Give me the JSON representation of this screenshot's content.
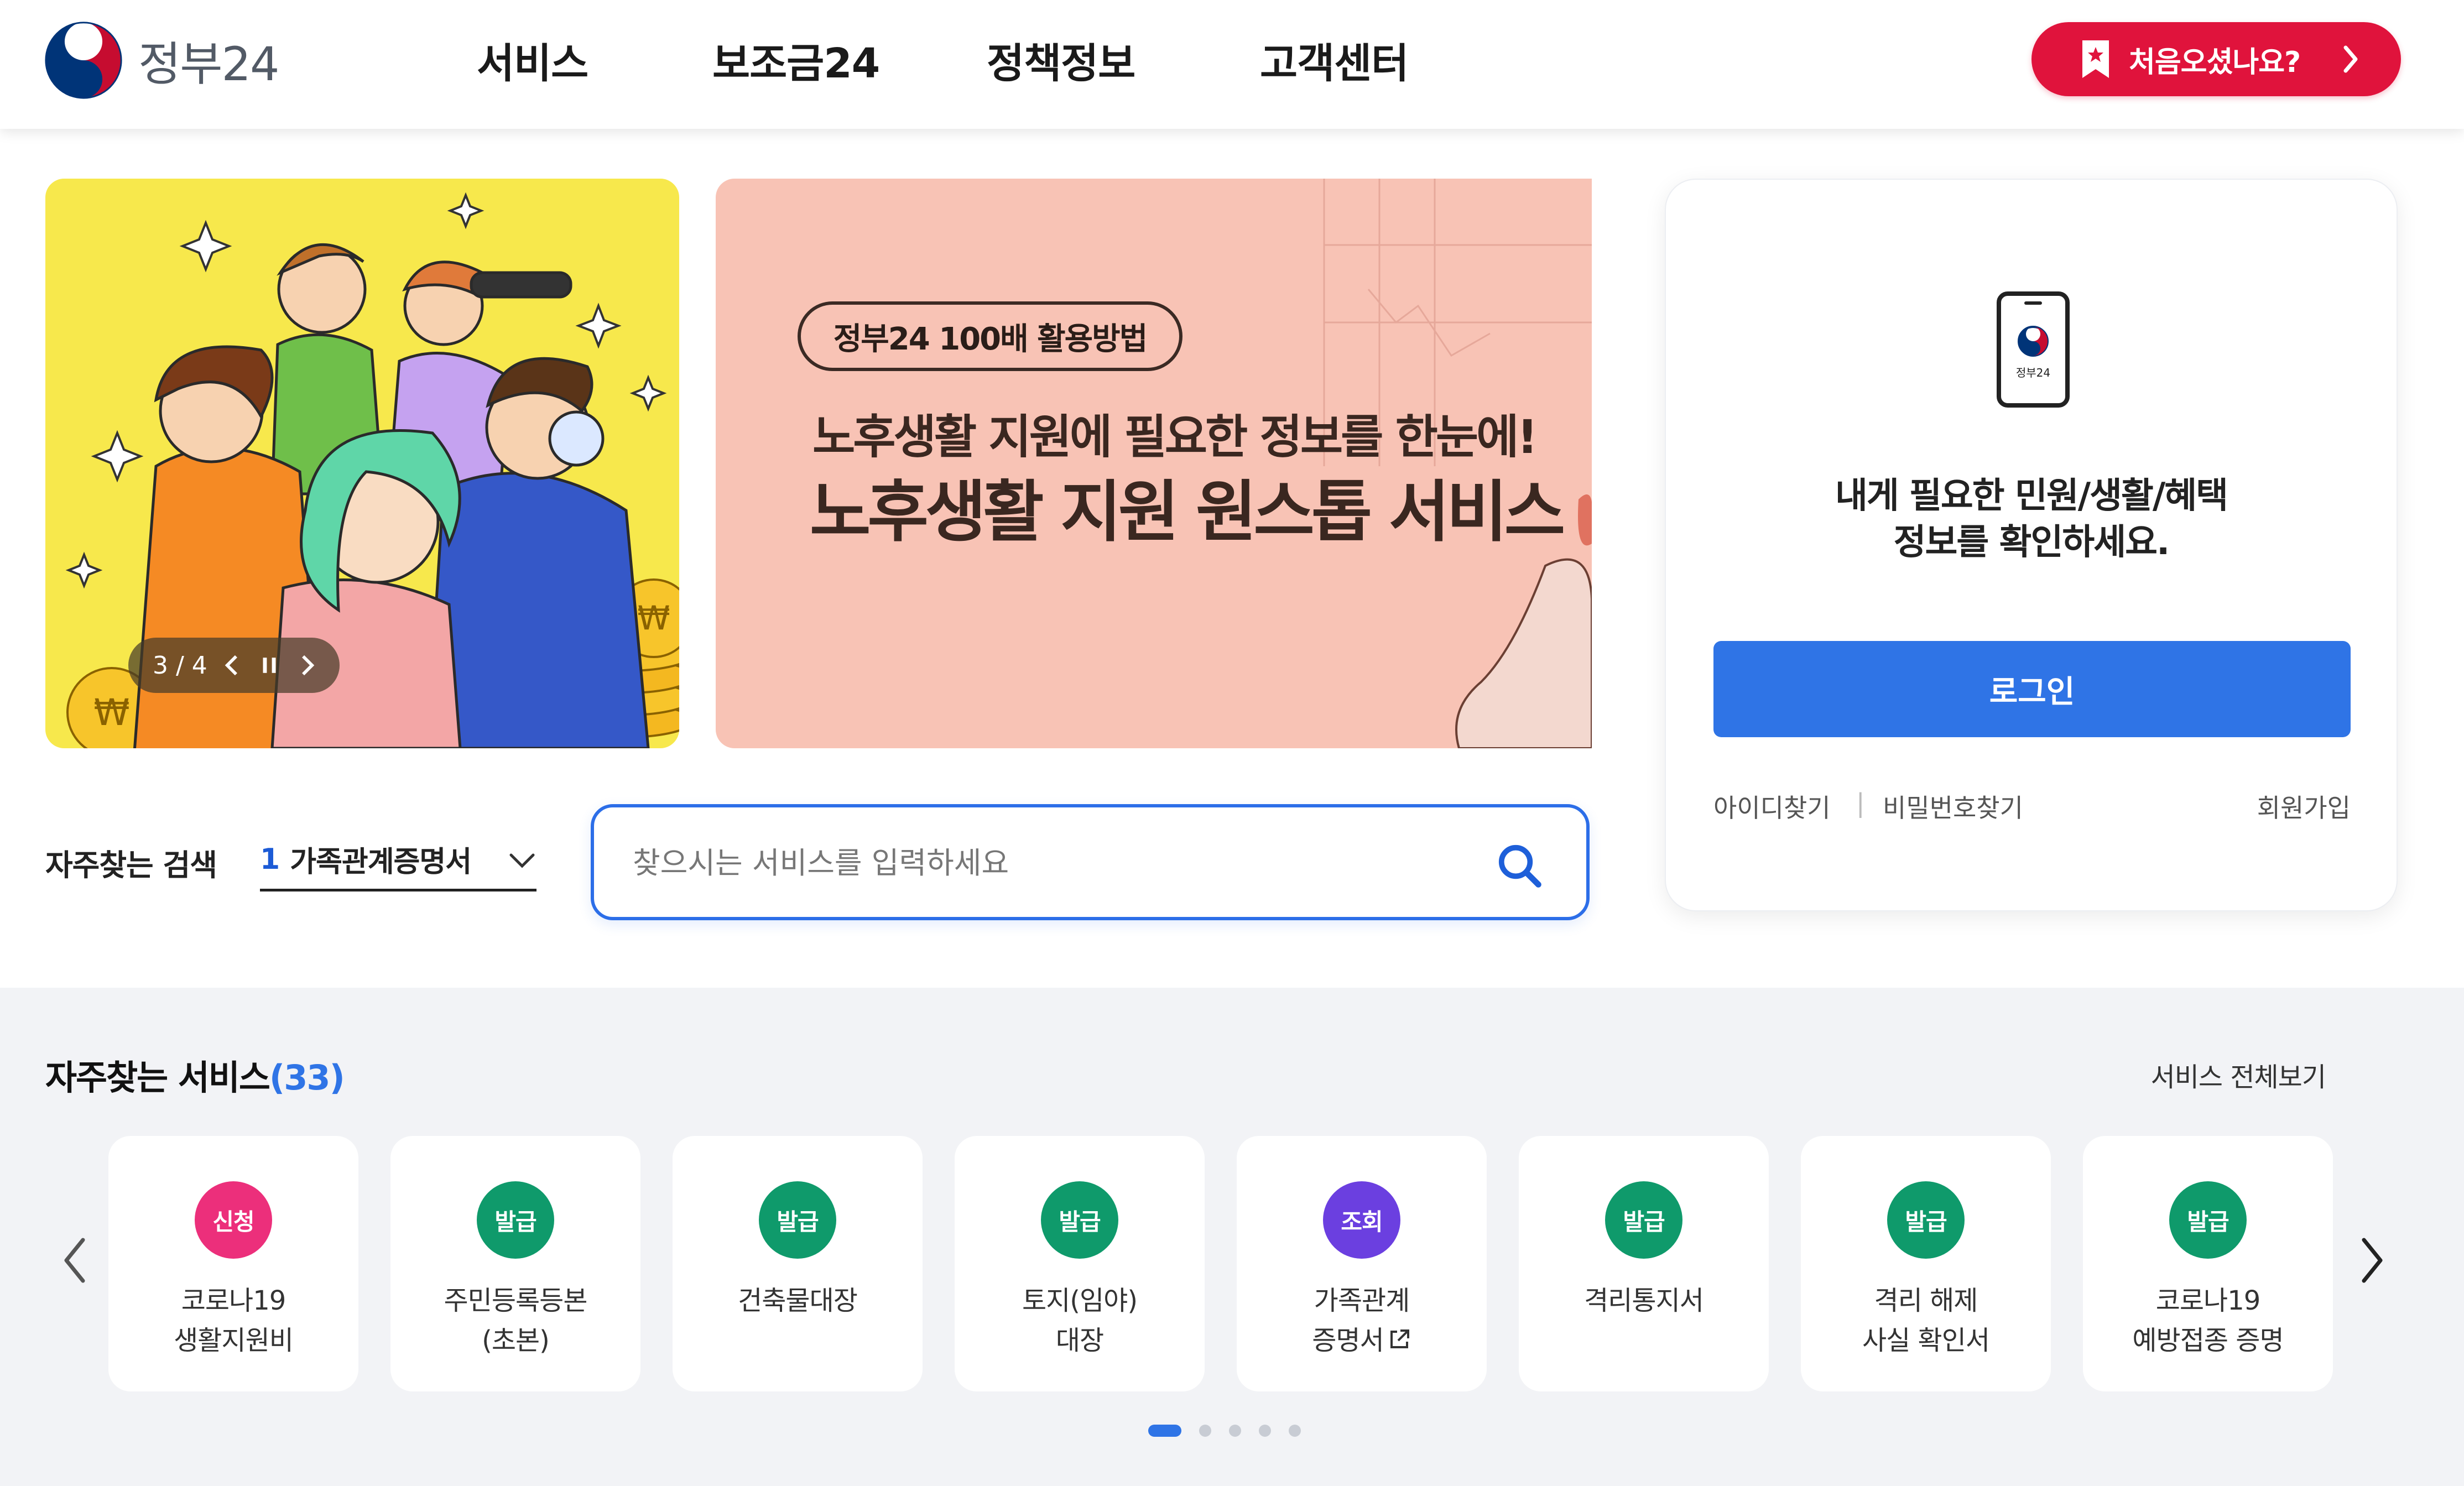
{
  "header": {
    "logo_text": "정부24",
    "nav": [
      "서비스",
      "보조금24",
      "정책정보",
      "고객센터"
    ],
    "cta_label": "처음오셨나요?"
  },
  "banner": {
    "slide_counter": "3 / 4",
    "pill_text": "정부24 100배 활용방법",
    "headline_line1": "노후생활 지원에 필요한 정보를 한눈에!",
    "headline_line2": "노후생활 지원 원스톱 서비스"
  },
  "search": {
    "frequent_label": "자주찾는 검색",
    "frequent_rank": "1",
    "frequent_value": "가족관계증명서",
    "placeholder": "찾으시는 서비스를 입력하세요"
  },
  "login": {
    "app_label": "정부24",
    "message_line1": "내게 필요한 민원/생활/혜택",
    "message_line2": "정보를 확인하세요.",
    "login_button": "로그인",
    "find_id": "아이디찾기",
    "find_password": "비밀번호찾기",
    "signup": "회원가입"
  },
  "services": {
    "title": "자주찾는 서비스",
    "count": "(33)",
    "view_all": "서비스 전체보기",
    "items": [
      {
        "badge": "신청",
        "line1": "코로나19",
        "line2": "생활지원비",
        "badge_color": "#ec2f7b"
      },
      {
        "badge": "발급",
        "line1": "주민등록등본",
        "line2": "(초본)",
        "badge_color": "#0f9a6b"
      },
      {
        "badge": "발급",
        "line1": "건축물대장",
        "line2": "",
        "badge_color": "#0f9a6b"
      },
      {
        "badge": "발급",
        "line1": "토지(임야)",
        "line2": "대장",
        "badge_color": "#0f9a6b"
      },
      {
        "badge": "조회",
        "line1": "가족관계",
        "line2": "증명서",
        "badge_color": "#6b3fe0"
      },
      {
        "badge": "발급",
        "line1": "격리통지서",
        "line2": "",
        "badge_color": "#0f9a6b"
      },
      {
        "badge": "발급",
        "line1": "격리 해제",
        "line2": "사실 확인서",
        "badge_color": "#0f9a6b"
      },
      {
        "badge": "발급",
        "line1": "코로나19",
        "line2": "예방접종 증명",
        "badge_color": "#0f9a6b"
      }
    ],
    "pagination_count": 5,
    "pagination_active": 1
  },
  "colors": {
    "accent_blue": "#2f74e6",
    "cta_red": "#e0133c",
    "banner_yellow": "#f7e84c",
    "banner_pink": "#f8c3b5"
  }
}
